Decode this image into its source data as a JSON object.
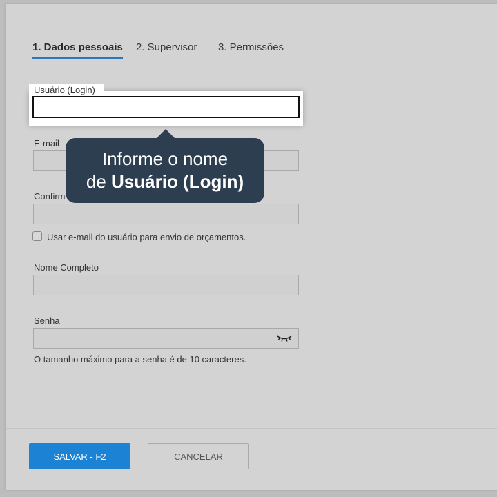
{
  "tabs": [
    {
      "label": "1. Dados pessoais"
    },
    {
      "label": "2. Supervisor"
    },
    {
      "label": "3. Permissões"
    }
  ],
  "form": {
    "login_label": "Usuário (Login)",
    "login_value": "",
    "email_label": "E-mail",
    "confirm_label": "Confirm",
    "checkbox_label": "Usar e-mail do usuário para envio de orçamentos.",
    "fullname_label": "Nome Completo",
    "password_label": "Senha",
    "password_hint": "O tamanho máximo para a senha é de 10 caracteres."
  },
  "tooltip": {
    "line1": "Informe o nome",
    "line2_prefix": "de ",
    "line2_bold": "Usuário (Login)"
  },
  "buttons": {
    "save": "SALVAR - F2",
    "cancel": "CANCELAR"
  },
  "icons": {
    "password_toggle": "eye-closed-icon"
  },
  "colors": {
    "accent": "#1b82d4",
    "tab_underline": "#2b78c2",
    "tooltip_bg": "#2c3e50"
  }
}
